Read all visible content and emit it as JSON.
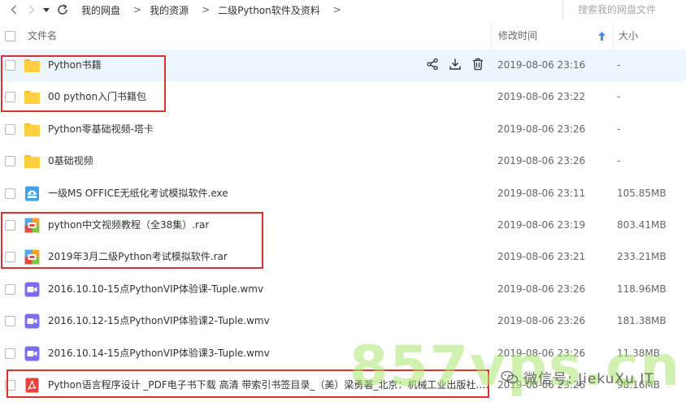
{
  "nav": {
    "breadcrumbs": [
      "我的网盘",
      "我的资源",
      "二级Python软件及资料"
    ],
    "search_placeholder": "搜索我的网盘文件"
  },
  "header": {
    "name_label": "文件名",
    "time_label": "修改时间",
    "size_label": "大小"
  },
  "files": [
    {
      "name": "Python书籍",
      "time": "2019-08-06 23:16",
      "size": "-",
      "type": "folder"
    },
    {
      "name": "00 python入门书籍包",
      "time": "2019-08-06 23:22",
      "size": "-",
      "type": "folder"
    },
    {
      "name": "Python零基础视频-塔卡",
      "time": "2019-08-06 23:26",
      "size": "-",
      "type": "folder"
    },
    {
      "name": "0基础视频",
      "time": "2019-08-06 23:26",
      "size": "-",
      "type": "folder"
    },
    {
      "name": "一级MS OFFICE无纸化考试模拟软件.exe",
      "time": "2019-08-06 23:11",
      "size": "105.85MB",
      "type": "exe"
    },
    {
      "name": "python中文视频教程（全38集）.rar",
      "time": "2019-08-06 23:19",
      "size": "803.41MB",
      "type": "rar"
    },
    {
      "name": "2019年3月二级Python考试模拟软件.rar",
      "time": "2019-08-06 23:21",
      "size": "233.21MB",
      "type": "rar"
    },
    {
      "name": "2016.10.10-15点PythonVIP体验课-Tuple.wmv",
      "time": "2019-08-06 23:26",
      "size": "118.96MB",
      "type": "video"
    },
    {
      "name": "2016.10.12-15点PythonVIP体验课2-Tuple.wmv",
      "time": "2019-08-06 23:26",
      "size": "181.38MB",
      "type": "video"
    },
    {
      "name": "2016.10.14-15点PythonVIP体验课3-Tuple.wmv",
      "time": "2019-08-06 23:26",
      "size": "11.38MB",
      "type": "video"
    },
    {
      "name": "Python语言程序设计 _PDF电子书下载 高清 带索引书签目录_（美）梁勇著_北京：机械工业出版社.p...",
      "time": "2019-08-06 23:26",
      "size": "98.16MB",
      "type": "pdf"
    }
  ],
  "watermark": {
    "main": "857vps.cn",
    "wechat": "微信号: JiekuXu IT"
  },
  "colors": {
    "accent": "#3b8cff",
    "highlight": "#d9322e",
    "folder": "#ffcf3f",
    "row_hover": "#edf5ff"
  }
}
